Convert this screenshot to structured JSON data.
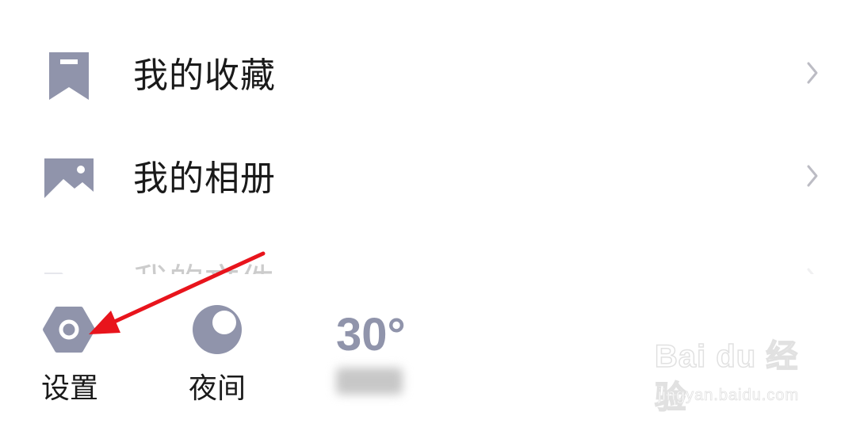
{
  "menu": {
    "items": [
      {
        "label": "我的收藏",
        "icon": "bookmark-icon"
      },
      {
        "label": "我的相册",
        "icon": "image-icon"
      },
      {
        "label": "我的文件",
        "icon": "folder-icon"
      }
    ]
  },
  "toolbar": {
    "settings_label": "设置",
    "night_label": "夜间",
    "weather_temp": "30°",
    "weather_desc": "晴"
  },
  "watermark": {
    "logo": "Bai du 经验",
    "url": "jingyan.baidu.com"
  },
  "colors": {
    "icon_gray": "#9094ab",
    "text": "#1a1a1a",
    "chevron": "#bcbcc4",
    "arrow": "#e8141c"
  }
}
